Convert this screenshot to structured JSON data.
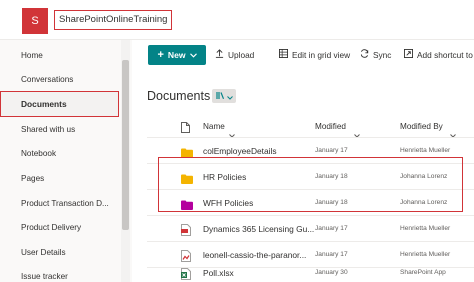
{
  "header": {
    "site_initial": "S",
    "site_title": "SharePointOnlineTraining"
  },
  "nav": {
    "items": [
      "Home",
      "Conversations",
      "Documents",
      "Shared with us",
      "Notebook",
      "Pages",
      "Product Transaction D...",
      "Product Delivery",
      "User Details",
      "Issue tracker"
    ],
    "selected": "Documents"
  },
  "toolbar": {
    "new_label": "New",
    "upload_label": "Upload",
    "grid_label": "Edit in grid view",
    "sync_label": "Sync",
    "shortcut_label": "Add shortcut to"
  },
  "library": {
    "title": "Documents",
    "columns": {
      "name": "Name",
      "modified": "Modified",
      "modified_by": "Modified By"
    },
    "rows": [
      {
        "name": "colEmployeeDetails",
        "modified": "January 17",
        "modified_by": "Henrietta Mueller",
        "icon": "folder-icon",
        "color": "#f4b400"
      },
      {
        "name": "HR Policies",
        "modified": "January 18",
        "modified_by": "Johanna Lorenz",
        "icon": "folder-icon",
        "color": "#f4b400"
      },
      {
        "name": "WFH Policies",
        "modified": "January 18",
        "modified_by": "Johanna Lorenz",
        "icon": "folder-icon",
        "color": "#b4009e"
      },
      {
        "name": "Dynamics 365 Licensing Gu...",
        "modified": "January 17",
        "modified_by": "Henrietta Mueller",
        "icon": "pdf-icon",
        "color": "#d13438"
      },
      {
        "name": "leonell-cassio-the-paranor...",
        "modified": "January 17",
        "modified_by": "Henrietta Mueller",
        "icon": "image-file-icon",
        "color": "#d13438"
      },
      {
        "name": "Poll.xlsx",
        "modified": "January 30",
        "modified_by": "SharePoint App",
        "icon": "excel-icon",
        "color": "#217346"
      }
    ]
  },
  "colors": {
    "accent": "#038387",
    "highlight": "#d13438",
    "site_icon": "#d13438"
  }
}
